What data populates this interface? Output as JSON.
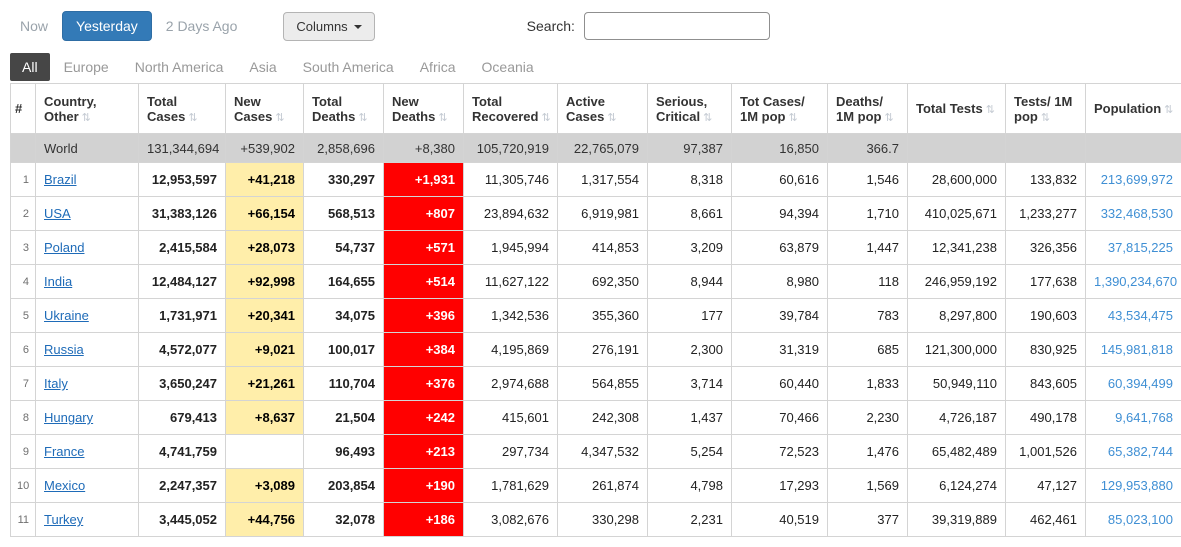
{
  "toolbar": {
    "now": "Now",
    "yesterday": "Yesterday",
    "two_days_ago": "2 Days Ago",
    "columns": "Columns",
    "search_label": "Search:",
    "search_value": ""
  },
  "tabs": {
    "items": [
      "All",
      "Europe",
      "North America",
      "Asia",
      "South America",
      "Africa",
      "Oceania"
    ],
    "active": "All"
  },
  "colors": {
    "accent_blue": "#337ab7",
    "active_tab_bg": "#464646",
    "new_cases_bg": "#FFEEAA",
    "new_deaths_bg": "#FF0000",
    "world_row_bg": "#d2d2d2",
    "country_link_blue": "#1e6bb8",
    "population_link_blue": "#3f8fd4"
  },
  "table": {
    "headers": [
      "#",
      "Country, Other",
      "Total Cases",
      "New Cases",
      "Total Deaths",
      "New Deaths",
      "Total Recovered",
      "Active Cases",
      "Serious, Critical",
      "Tot Cases/ 1M pop",
      "Deaths/ 1M pop",
      "Total Tests",
      "Tests/ 1M pop",
      "Population"
    ],
    "sort_icon_glyph": "⇅",
    "world": {
      "name": "World",
      "total_cases": "131,344,694",
      "new_cases": "+539,902",
      "total_deaths": "2,858,696",
      "new_deaths": "+8,380",
      "total_recovered": "105,720,919",
      "active_cases": "22,765,079",
      "serious_critical": "97,387",
      "cases_per_1m": "16,850",
      "deaths_per_1m": "366.7",
      "total_tests": "",
      "tests_per_1m": "",
      "population": ""
    },
    "rows": [
      {
        "rank": "1",
        "country": "Brazil",
        "total_cases": "12,953,597",
        "new_cases": "+41,218",
        "total_deaths": "330,297",
        "new_deaths": "+1,931",
        "total_recovered": "11,305,746",
        "active_cases": "1,317,554",
        "serious_critical": "8,318",
        "cases_per_1m": "60,616",
        "deaths_per_1m": "1,546",
        "total_tests": "28,600,000",
        "tests_per_1m": "133,832",
        "population": "213,699,972"
      },
      {
        "rank": "2",
        "country": "USA",
        "total_cases": "31,383,126",
        "new_cases": "+66,154",
        "total_deaths": "568,513",
        "new_deaths": "+807",
        "total_recovered": "23,894,632",
        "active_cases": "6,919,981",
        "serious_critical": "8,661",
        "cases_per_1m": "94,394",
        "deaths_per_1m": "1,710",
        "total_tests": "410,025,671",
        "tests_per_1m": "1,233,277",
        "population": "332,468,530"
      },
      {
        "rank": "3",
        "country": "Poland",
        "total_cases": "2,415,584",
        "new_cases": "+28,073",
        "total_deaths": "54,737",
        "new_deaths": "+571",
        "total_recovered": "1,945,994",
        "active_cases": "414,853",
        "serious_critical": "3,209",
        "cases_per_1m": "63,879",
        "deaths_per_1m": "1,447",
        "total_tests": "12,341,238",
        "tests_per_1m": "326,356",
        "population": "37,815,225"
      },
      {
        "rank": "4",
        "country": "India",
        "total_cases": "12,484,127",
        "new_cases": "+92,998",
        "total_deaths": "164,655",
        "new_deaths": "+514",
        "total_recovered": "11,627,122",
        "active_cases": "692,350",
        "serious_critical": "8,944",
        "cases_per_1m": "8,980",
        "deaths_per_1m": "118",
        "total_tests": "246,959,192",
        "tests_per_1m": "177,638",
        "population": "1,390,234,670"
      },
      {
        "rank": "5",
        "country": "Ukraine",
        "total_cases": "1,731,971",
        "new_cases": "+20,341",
        "total_deaths": "34,075",
        "new_deaths": "+396",
        "total_recovered": "1,342,536",
        "active_cases": "355,360",
        "serious_critical": "177",
        "cases_per_1m": "39,784",
        "deaths_per_1m": "783",
        "total_tests": "8,297,800",
        "tests_per_1m": "190,603",
        "population": "43,534,475"
      },
      {
        "rank": "6",
        "country": "Russia",
        "total_cases": "4,572,077",
        "new_cases": "+9,021",
        "total_deaths": "100,017",
        "new_deaths": "+384",
        "total_recovered": "4,195,869",
        "active_cases": "276,191",
        "serious_critical": "2,300",
        "cases_per_1m": "31,319",
        "deaths_per_1m": "685",
        "total_tests": "121,300,000",
        "tests_per_1m": "830,925",
        "population": "145,981,818"
      },
      {
        "rank": "7",
        "country": "Italy",
        "total_cases": "3,650,247",
        "new_cases": "+21,261",
        "total_deaths": "110,704",
        "new_deaths": "+376",
        "total_recovered": "2,974,688",
        "active_cases": "564,855",
        "serious_critical": "3,714",
        "cases_per_1m": "60,440",
        "deaths_per_1m": "1,833",
        "total_tests": "50,949,110",
        "tests_per_1m": "843,605",
        "population": "60,394,499"
      },
      {
        "rank": "8",
        "country": "Hungary",
        "total_cases": "679,413",
        "new_cases": "+8,637",
        "total_deaths": "21,504",
        "new_deaths": "+242",
        "total_recovered": "415,601",
        "active_cases": "242,308",
        "serious_critical": "1,437",
        "cases_per_1m": "70,466",
        "deaths_per_1m": "2,230",
        "total_tests": "4,726,187",
        "tests_per_1m": "490,178",
        "population": "9,641,768"
      },
      {
        "rank": "9",
        "country": "France",
        "total_cases": "4,741,759",
        "new_cases": "",
        "total_deaths": "96,493",
        "new_deaths": "+213",
        "total_recovered": "297,734",
        "active_cases": "4,347,532",
        "serious_critical": "5,254",
        "cases_per_1m": "72,523",
        "deaths_per_1m": "1,476",
        "total_tests": "65,482,489",
        "tests_per_1m": "1,001,526",
        "population": "65,382,744"
      },
      {
        "rank": "10",
        "country": "Mexico",
        "total_cases": "2,247,357",
        "new_cases": "+3,089",
        "total_deaths": "203,854",
        "new_deaths": "+190",
        "total_recovered": "1,781,629",
        "active_cases": "261,874",
        "serious_critical": "4,798",
        "cases_per_1m": "17,293",
        "deaths_per_1m": "1,569",
        "total_tests": "6,124,274",
        "tests_per_1m": "47,127",
        "population": "129,953,880"
      },
      {
        "rank": "11",
        "country": "Turkey",
        "total_cases": "3,445,052",
        "new_cases": "+44,756",
        "total_deaths": "32,078",
        "new_deaths": "+186",
        "total_recovered": "3,082,676",
        "active_cases": "330,298",
        "serious_critical": "2,231",
        "cases_per_1m": "40,519",
        "deaths_per_1m": "377",
        "total_tests": "39,319,889",
        "tests_per_1m": "462,461",
        "population": "85,023,100"
      }
    ]
  }
}
